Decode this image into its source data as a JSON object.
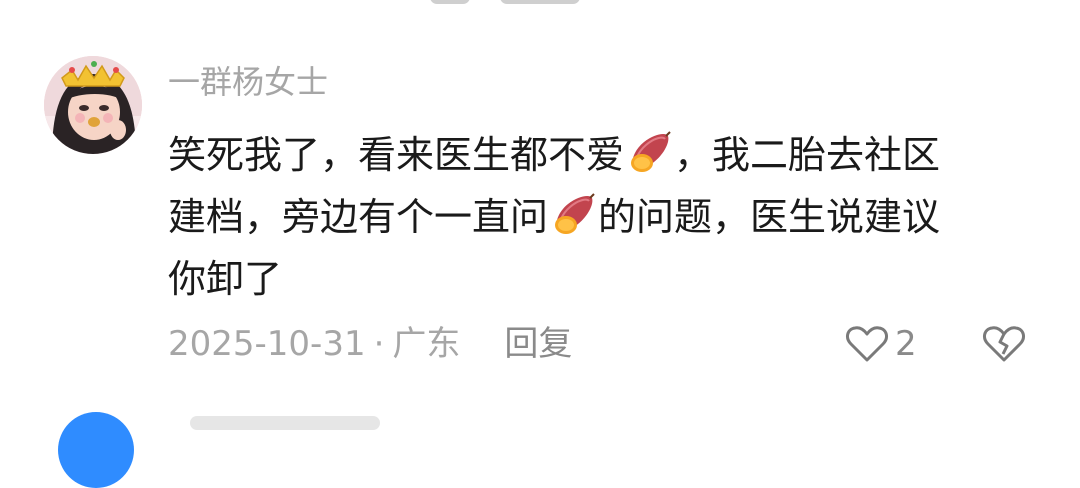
{
  "comment": {
    "username": "一群杨女士",
    "text_line1_a": "笑死我了，看来医生都不爱",
    "text_line1_b": "，我二胎去社区",
    "text_line2_a": "建档，旁边有个一直问",
    "text_line2_b": "的问题，医生说建议",
    "text_line3": "你卸了",
    "emoji_icon": "sweet-potato-icon",
    "date": "2025-10-31",
    "separator": "·",
    "location": "广东",
    "reply_label": "回复",
    "like_count": "2"
  },
  "colors": {
    "text": "#1a1a1a",
    "muted": "#a6a6a6",
    "next_avatar": "#2f8cff"
  }
}
